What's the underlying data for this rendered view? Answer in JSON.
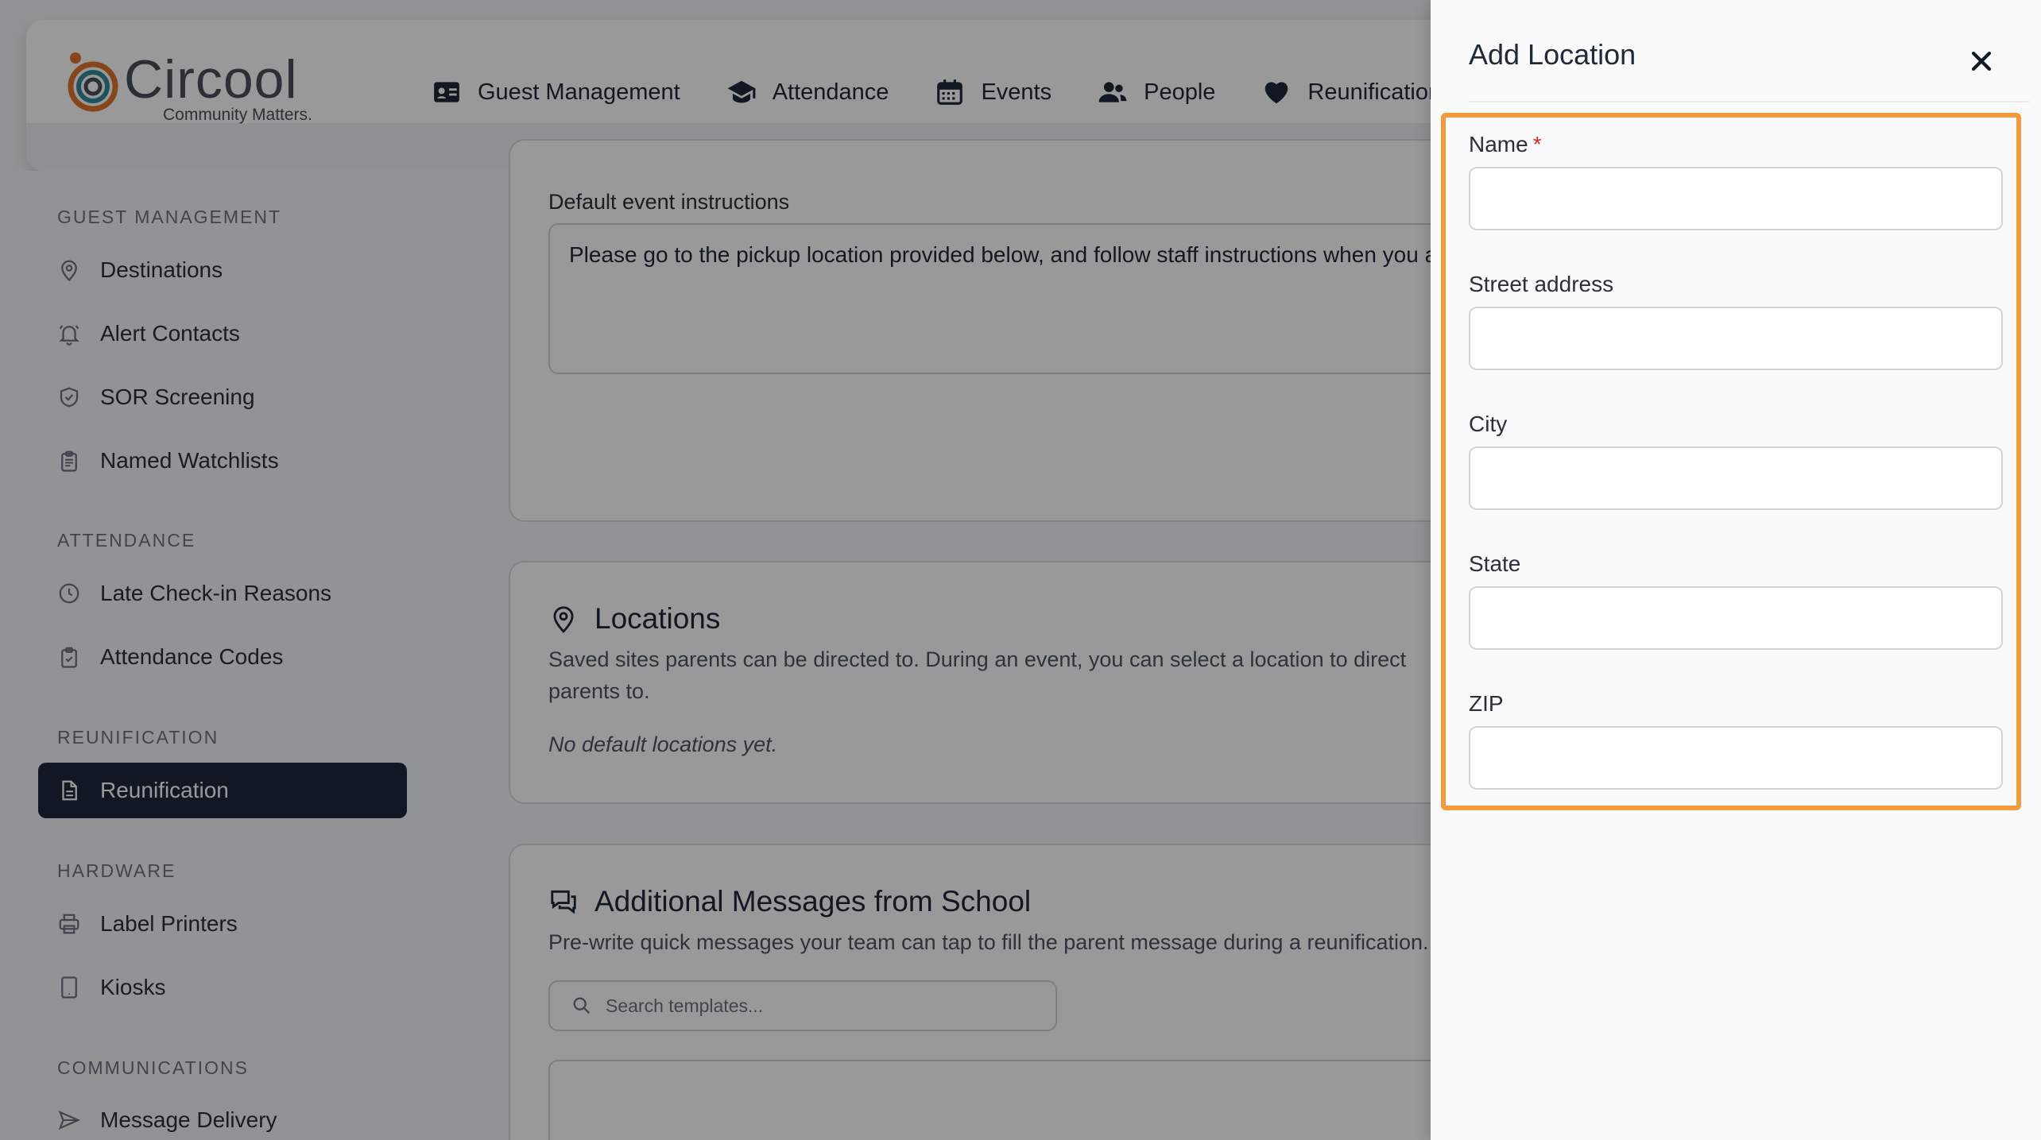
{
  "brand": {
    "name": "Circool",
    "tagline": "Community Matters."
  },
  "nav": [
    {
      "label": "Guest Management",
      "icon": "id-card-icon"
    },
    {
      "label": "Attendance",
      "icon": "graduation-cap-icon"
    },
    {
      "label": "Events",
      "icon": "calendar-icon"
    },
    {
      "label": "People",
      "icon": "users-icon"
    },
    {
      "label": "Reunification",
      "icon": "heart-icon"
    }
  ],
  "sidebar": {
    "sections": [
      {
        "title": "GUEST MANAGEMENT",
        "items": [
          {
            "label": "Destinations",
            "icon": "map-pin-icon"
          },
          {
            "label": "Alert Contacts",
            "icon": "bell-icon"
          },
          {
            "label": "SOR Screening",
            "icon": "shield-icon"
          },
          {
            "label": "Named Watchlists",
            "icon": "clipboard-list-icon"
          }
        ]
      },
      {
        "title": "ATTENDANCE",
        "items": [
          {
            "label": "Late Check-in Reasons",
            "icon": "clock-icon"
          },
          {
            "label": "Attendance Codes",
            "icon": "clipboard-check-icon"
          }
        ]
      },
      {
        "title": "REUNIFICATION",
        "items": [
          {
            "label": "Reunification",
            "icon": "file-icon",
            "active": true
          }
        ]
      },
      {
        "title": "HARDWARE",
        "items": [
          {
            "label": "Label Printers",
            "icon": "printer-icon"
          },
          {
            "label": "Kiosks",
            "icon": "tablet-icon"
          }
        ]
      },
      {
        "title": "COMMUNICATIONS",
        "items": [
          {
            "label": "Message Delivery",
            "icon": "send-icon"
          }
        ]
      }
    ]
  },
  "main": {
    "instructions": {
      "label": "Default event instructions",
      "value": "Please go to the pickup location provided below, and follow staff instructions when you arrive."
    },
    "locations": {
      "title": "Locations",
      "description": "Saved sites parents can be directed to. During an event, you can select a location to direct parents to.",
      "empty": "No default locations yet."
    },
    "messages": {
      "title": "Additional Messages from School",
      "description": "Pre-write quick messages your team can tap to fill the parent message during a reunification.",
      "search_placeholder": "Search templates..."
    }
  },
  "drawer": {
    "title": "Add Location",
    "fields": {
      "name": {
        "label": "Name",
        "required_mark": "*",
        "value": ""
      },
      "street": {
        "label": "Street address",
        "value": ""
      },
      "city": {
        "label": "City",
        "value": ""
      },
      "state": {
        "label": "State",
        "value": ""
      },
      "zip": {
        "label": "ZIP",
        "value": ""
      }
    },
    "highlight_color": "#f59a3a"
  },
  "colors": {
    "active_nav": "#1e293b",
    "accent": "#f59a3a",
    "required": "#dc2626"
  }
}
